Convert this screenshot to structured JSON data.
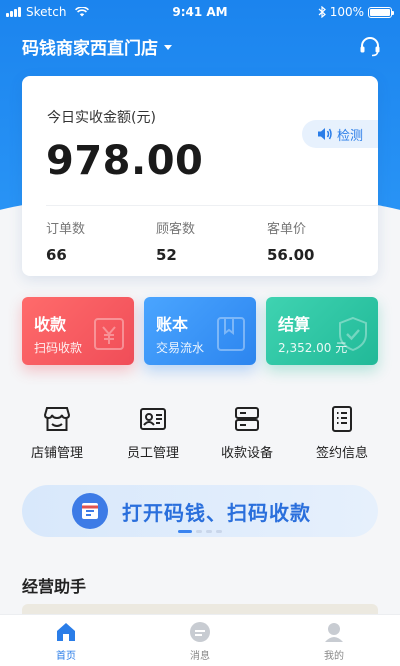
{
  "status_bar": {
    "carrier": "Sketch",
    "time": "9:41 AM",
    "battery": "100%"
  },
  "header": {
    "store_name": "码钱商家西直门店"
  },
  "summary": {
    "label": "今日实收金额(元)",
    "amount": "978.00",
    "detect_label": "检测",
    "stats": [
      {
        "label": "订单数",
        "value": "66"
      },
      {
        "label": "顾客数",
        "value": "52"
      },
      {
        "label": "客单价",
        "value": "56.00"
      }
    ]
  },
  "tiles": [
    {
      "title": "收款",
      "subtitle": "扫码收款"
    },
    {
      "title": "账本",
      "subtitle": "交易流水"
    },
    {
      "title": "结算",
      "subtitle": "2,352.00 元"
    }
  ],
  "quick_menu": [
    {
      "label": "店铺管理",
      "icon": "store-icon"
    },
    {
      "label": "员工管理",
      "icon": "staff-card-icon"
    },
    {
      "label": "收款设备",
      "icon": "device-icon"
    },
    {
      "label": "签约信息",
      "icon": "contract-icon"
    }
  ],
  "banner": {
    "text": "打开码钱、扫码收款"
  },
  "section": {
    "title": "经营助手"
  },
  "tab_bar": [
    {
      "label": "首页",
      "active": true
    },
    {
      "label": "消息",
      "active": false
    },
    {
      "label": "我的",
      "active": false
    }
  ],
  "colors": {
    "primary": "#2a7de8",
    "collect": "#f04d58",
    "ledger": "#2c85ef",
    "settle": "#21b998"
  }
}
